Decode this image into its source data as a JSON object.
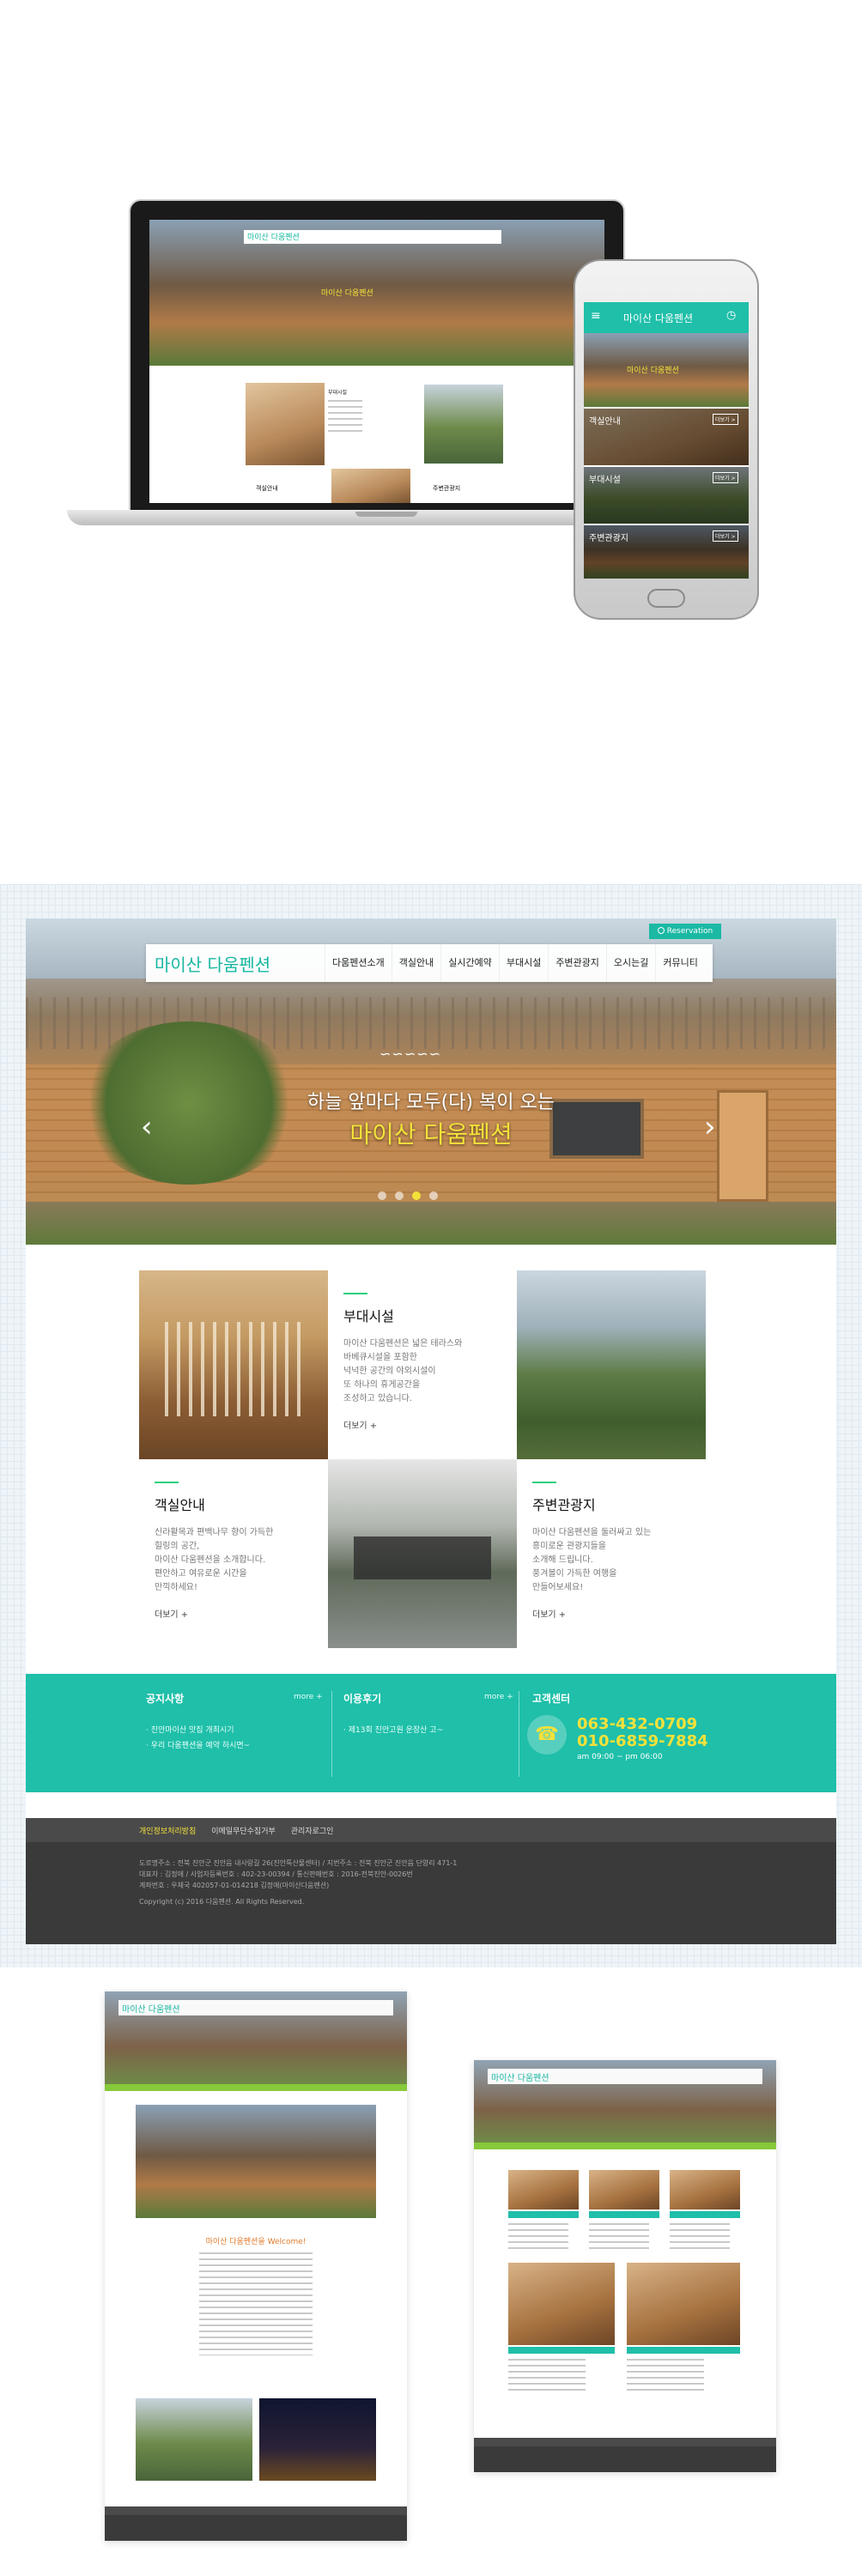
{
  "brand": {
    "name": "마이산 다움펜션",
    "colors": {
      "accent": "#1bb9a4",
      "highlight": "#f3e13a",
      "green": "#2ad07c",
      "footer": "#3a3a3a"
    }
  },
  "nav": {
    "items": [
      "다움펜션소개",
      "객실안내",
      "실시간예약",
      "부대시설",
      "주변관광지",
      "오시는길",
      "커뮤니티"
    ],
    "reservation": "Reservation"
  },
  "hero": {
    "line1": "하늘 앞마다 모두(다) 복이 오는",
    "line2": "마이산 다움펜션",
    "arrow_left": "‹",
    "arrow_right": "›"
  },
  "features": {
    "facilities": {
      "title": "부대시설",
      "lines": [
        "마이산 다움펜션은 넓은 테라스와",
        "바베큐시설을 포함한",
        "넉넉한 공간의 야외시설이",
        "또 하나의 휴게공간을",
        "조성하고 있습니다."
      ],
      "more": "더보기 +"
    },
    "rooms": {
      "title": "객실안내",
      "lines": [
        "신라활목과 편백나무 향이 가득한",
        "힐링의 공간,",
        "마이산 다움펜션을 소개합니다.",
        "편안하고 여유로운 시간을",
        "만끽하세요!"
      ],
      "more": "더보기 +"
    },
    "tourism": {
      "title": "주변관광지",
      "lines": [
        "마이산 다움펜션을 둘러싸고 있는",
        "흥미로운 관광지들을",
        "소개해 드립니다.",
        "풍겨볼이 가득한 여행을",
        "만들어보세요!"
      ],
      "more": "더보기 +"
    }
  },
  "info": {
    "notice": {
      "title": "공지사항",
      "more": "more +",
      "items": [
        "진안마이산 맛집 개최시기",
        "우리 다움펜션을 예약 하시면~"
      ]
    },
    "reviews": {
      "title": "이용후기",
      "more": "more +",
      "items": [
        "제13회 진안고원 운장산 고~"
      ]
    },
    "contact": {
      "title": "고객센터",
      "icon": "phone-icon",
      "tel1": "063-432-0709",
      "tel2": "010-6859-7884",
      "hours": "am 09:00 ~ pm 06:00"
    }
  },
  "footer": {
    "links": [
      "개인정보처리방침",
      "이메일무단수집거부",
      "관리자로그인"
    ],
    "lines": [
      "도로명주소 : 전북 진안군 진안읍 내사랑길 26(진안특산물센터) / 지번주소 : 전북 진안군 진안읍 단양리 471-1",
      "대표자 : 김정애 / 사업자등록번호 : 402-23-00394 / 통신판매번호 : 2016-전북진안-0026번",
      "계좌번호 : 우체국 402057-01-014218 김정애(마이산다움펜션)"
    ],
    "copyright": "Copyright (c) 2016 다움펜션. All Rights Reserved."
  },
  "mockups": {
    "laptop_logo": "마이산 다움펜션",
    "laptop_labels": [
      "객실안내",
      "주변관광지",
      "부대시설"
    ],
    "phone_logo": "마이산 다움펜션",
    "phone_tiles": [
      "객실안내",
      "부대시설",
      "주변관광지"
    ],
    "more_button": "더보기 >"
  },
  "subpages": {
    "left_logo": "마이산 다움펜션",
    "left_caption": "마이산 다움펜션을 Welcome!",
    "right_logo": "마이산 다움펜션"
  }
}
